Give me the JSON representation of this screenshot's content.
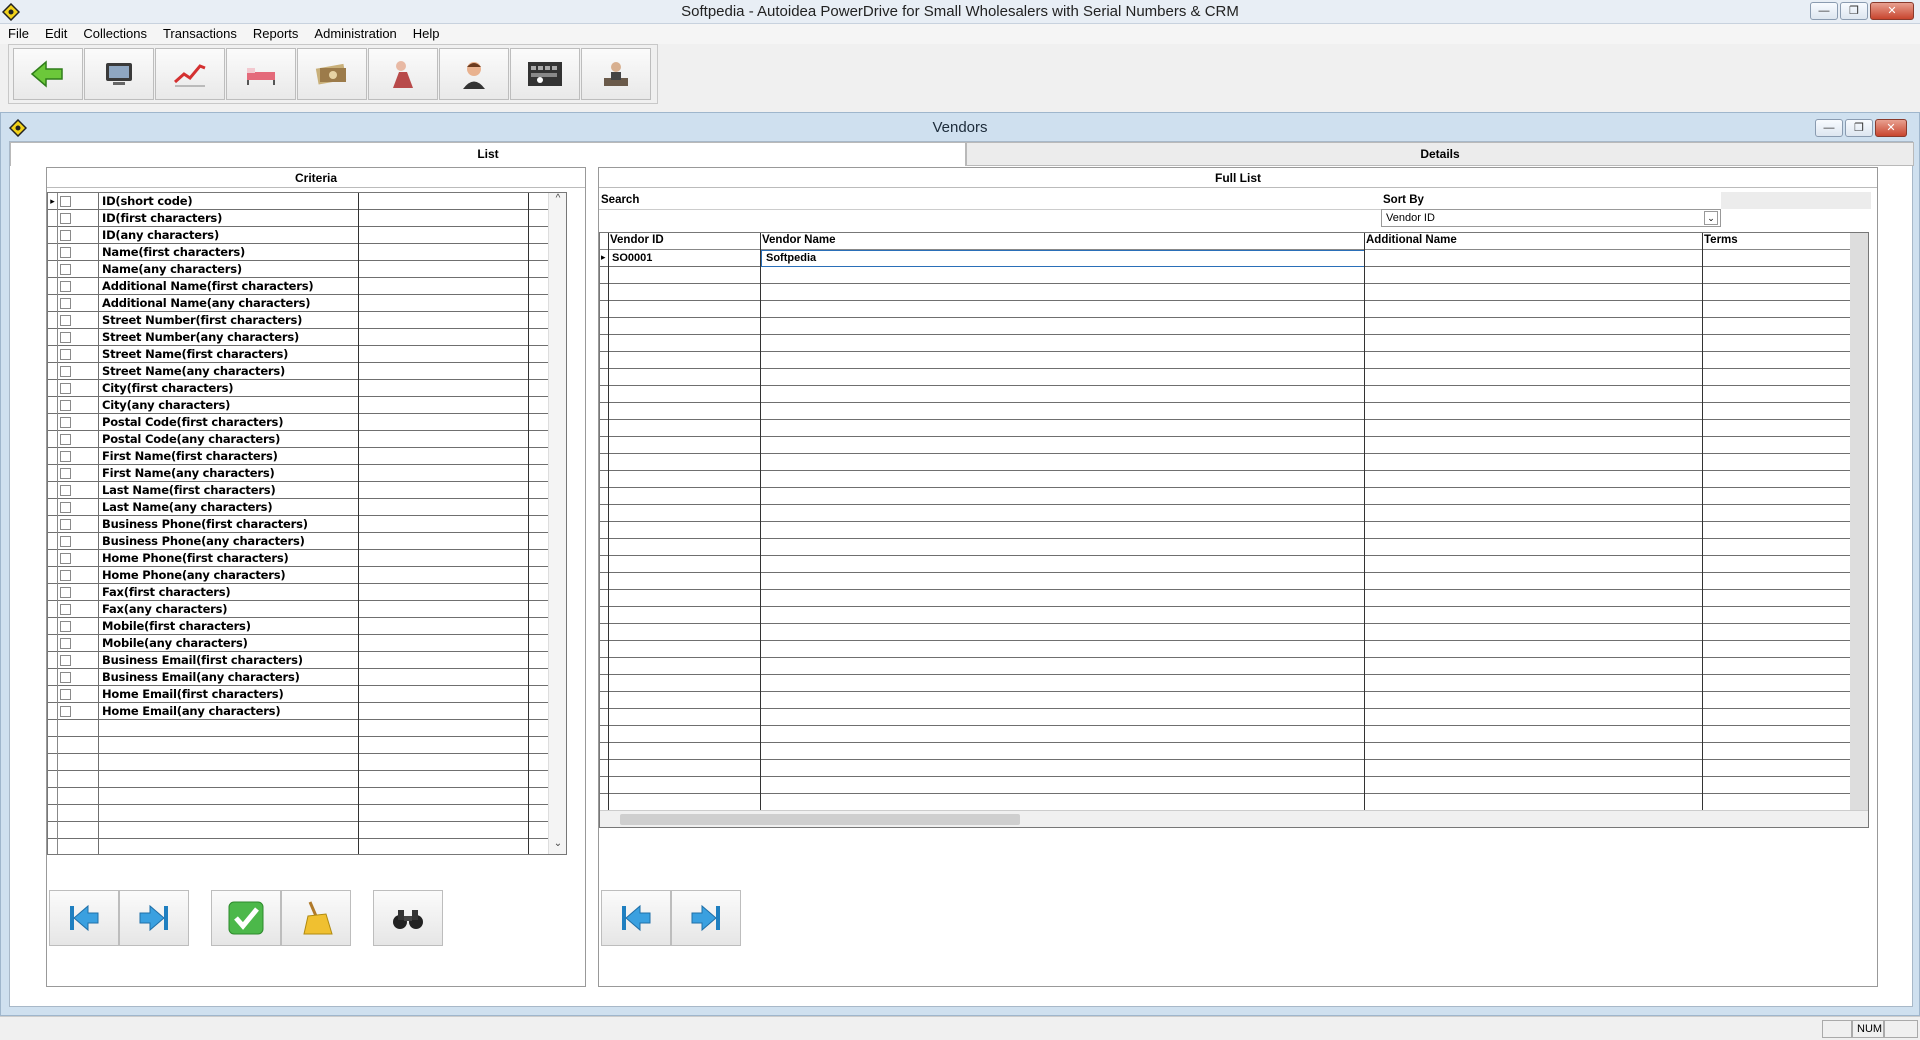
{
  "window": {
    "title": "Softpedia - Autoidea PowerDrive for Small Wholesalers with Serial Numbers & CRM"
  },
  "menu": [
    "File",
    "Edit",
    "Collections",
    "Transactions",
    "Reports",
    "Administration",
    "Help"
  ],
  "toolbar": [
    {
      "name": "back-arrow-icon"
    },
    {
      "name": "monitor-icon"
    },
    {
      "name": "chart-trend-icon"
    },
    {
      "name": "bed-icon"
    },
    {
      "name": "money-icon"
    },
    {
      "name": "person-icon"
    },
    {
      "name": "customer-service-icon"
    },
    {
      "name": "keyboard-icon"
    },
    {
      "name": "worker-icon"
    }
  ],
  "child": {
    "title": "Vendors"
  },
  "tabs": {
    "list": "List",
    "details": "Details"
  },
  "criteria": {
    "header": "Criteria",
    "items": [
      "ID(short code)",
      "ID(first characters)",
      "ID(any characters)",
      "Name(first characters)",
      "Name(any characters)",
      "Additional Name(first characters)",
      "Additional Name(any characters)",
      "Street Number(first characters)",
      "Street Number(any characters)",
      "Street Name(first characters)",
      "Street Name(any characters)",
      "City(first characters)",
      "City(any characters)",
      "Postal Code(first characters)",
      "Postal Code(any characters)",
      "First Name(first characters)",
      "First Name(any characters)",
      "Last Name(first characters)",
      "Last Name(any characters)",
      "Business Phone(first characters)",
      "Business Phone(any characters)",
      "Home Phone(first characters)",
      "Home Phone(any characters)",
      "Fax(first characters)",
      "Fax(any characters)",
      "Mobile(first characters)",
      "Mobile(any characters)",
      "Business Email(first characters)",
      "Business Email(any characters)",
      "Home Email(first characters)",
      "Home Email(any characters)"
    ]
  },
  "full_list": {
    "header": "Full List",
    "search_label": "Search",
    "search_value": "",
    "sort_label": "Sort By",
    "sort_value": "Vendor ID",
    "columns": [
      "Vendor ID",
      "Vendor Name",
      "Additional Name",
      "Terms"
    ],
    "rows": [
      [
        "SO0001",
        "Softpedia",
        "",
        ""
      ]
    ]
  },
  "status": {
    "num": "NUM"
  }
}
